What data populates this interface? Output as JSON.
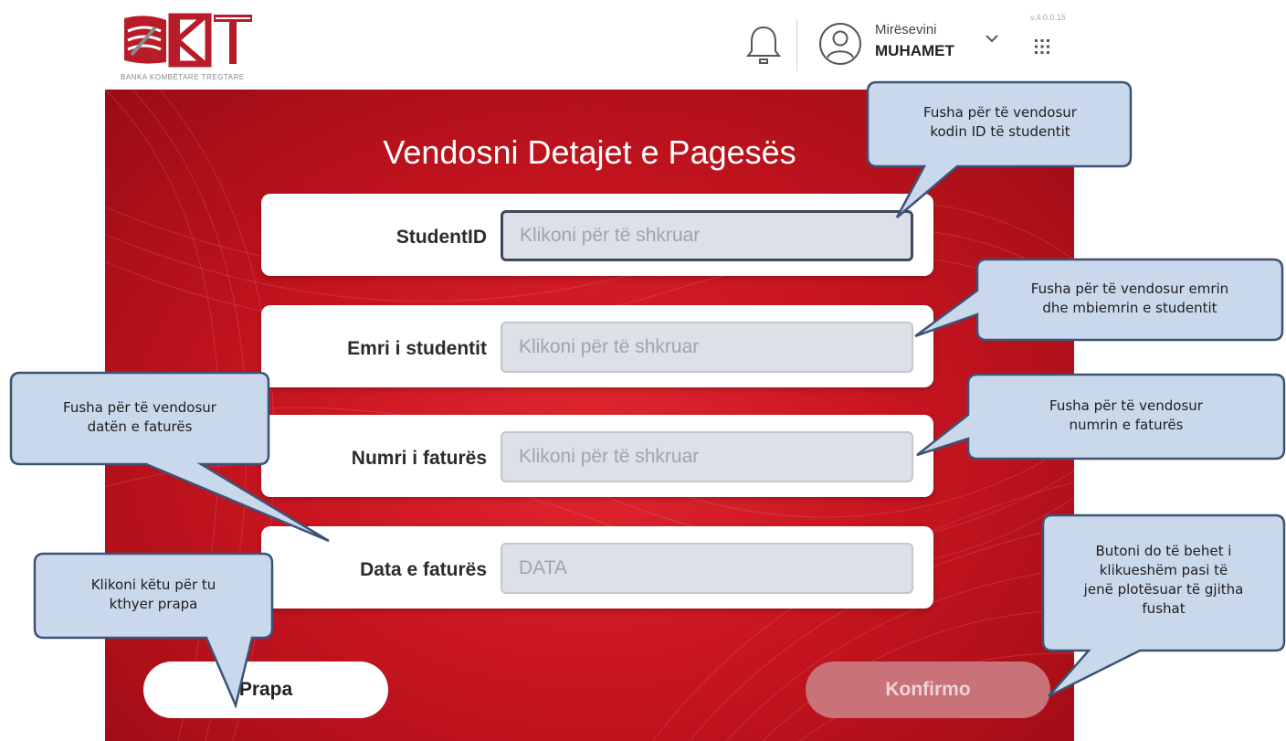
{
  "brand": {
    "logo_text": "BKT",
    "subtitle": "BANKA KOMBËTARE TREGTARE"
  },
  "header": {
    "greeting": "Mirësevini",
    "username": "MUHAMET",
    "version": "v.4.0.0.15"
  },
  "page": {
    "title": "Vendosni Detajet e Pagesës"
  },
  "fields": [
    {
      "label": "StudentID",
      "placeholder": "Klikoni për të shkruar"
    },
    {
      "label": "Emri i studentit",
      "placeholder": "Klikoni për të shkruar"
    },
    {
      "label": "Numri i faturës",
      "placeholder": "Klikoni për të shkruar"
    },
    {
      "label": "Data e faturës",
      "placeholder": "DATA"
    }
  ],
  "buttons": {
    "back": "Prapa",
    "confirm": "Konfirmo"
  },
  "callouts": {
    "student_id": [
      "Fusha për të vendosur",
      "kodin ID të studentit"
    ],
    "student_name": [
      "Fusha për të vendosur emrin",
      "dhe mbiemrin e studentit"
    ],
    "invoice_number": [
      "Fusha për të vendosur",
      "numrin e faturës"
    ],
    "invoice_date": [
      "Fusha për të vendosur",
      "datën e faturës"
    ],
    "back": [
      "Klikoni këtu për tu",
      "kthyer prapa"
    ],
    "confirm": [
      "Butoni do të behet i",
      "klikueshëm pasi të",
      "jenë plotësuar të gjitha",
      "fushat"
    ]
  },
  "colors": {
    "brand_red": "#c81520",
    "callout_fill": "#cad8ec",
    "callout_stroke": "#3c5377",
    "confirm_disabled": "#c97278"
  },
  "icons": {
    "bell": "bell-icon",
    "avatar": "user-avatar-icon",
    "chevron": "chevron-down-icon",
    "apps": "apps-grid-icon"
  }
}
